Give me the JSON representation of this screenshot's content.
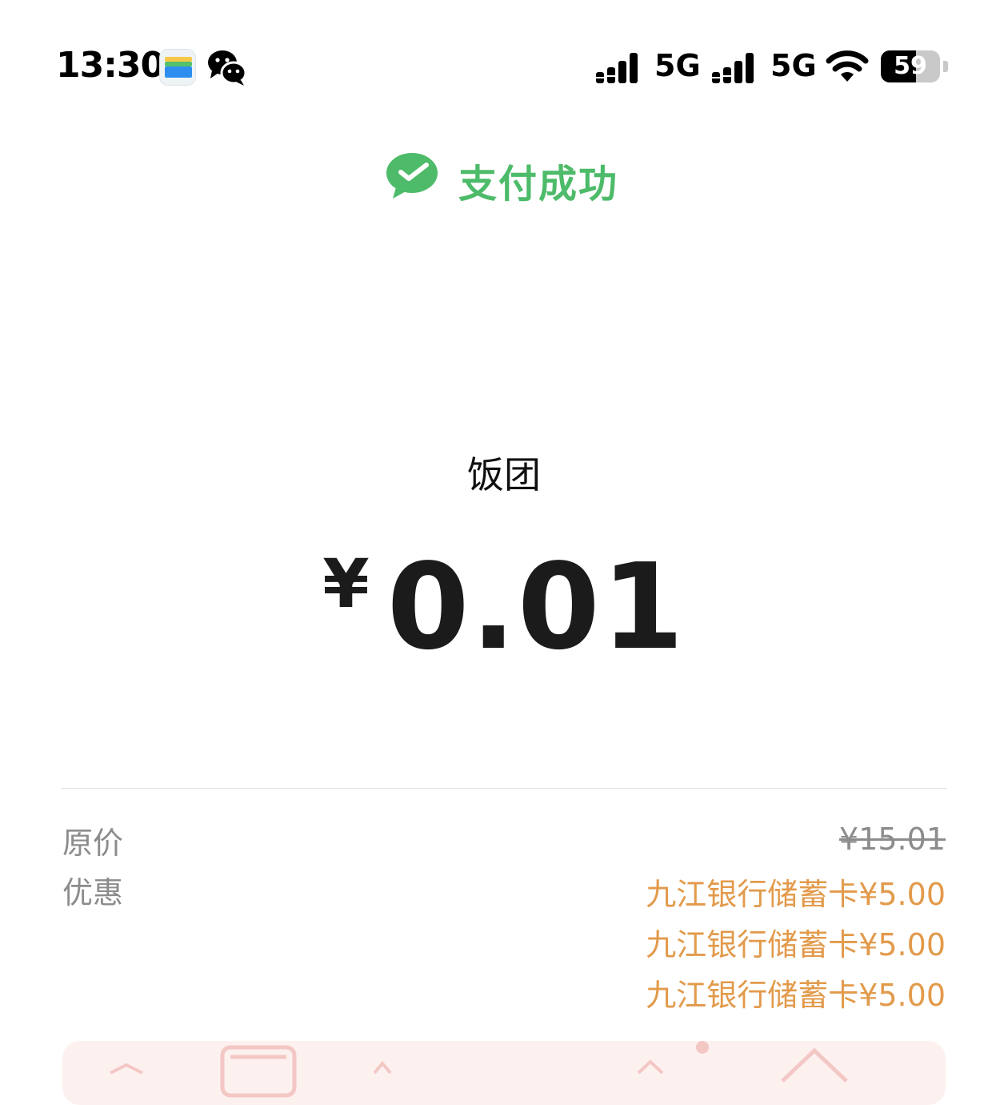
{
  "status_bar": {
    "time": "13:30",
    "signal_1_label": "5G",
    "signal_2_label": "5G",
    "battery": "59",
    "icons": [
      "wallet-app-icon",
      "wechat-icon",
      "signal-icon",
      "signal-icon",
      "wifi-icon",
      "battery-icon"
    ]
  },
  "header": {
    "icon": "wechat-pay-check-icon",
    "title": "支付成功",
    "accent_color": "#4dbb69"
  },
  "payment": {
    "merchant": "饭团",
    "currency": "¥",
    "amount": "0.01"
  },
  "details": {
    "original_price_label": "原价",
    "original_price": "¥15.01",
    "discount_label": "优惠",
    "discounts": [
      "九江银行储蓄卡¥5.00",
      "九江银行储蓄卡¥5.00",
      "九江银行储蓄卡¥5.00"
    ],
    "discount_color": "#e29a4b"
  }
}
